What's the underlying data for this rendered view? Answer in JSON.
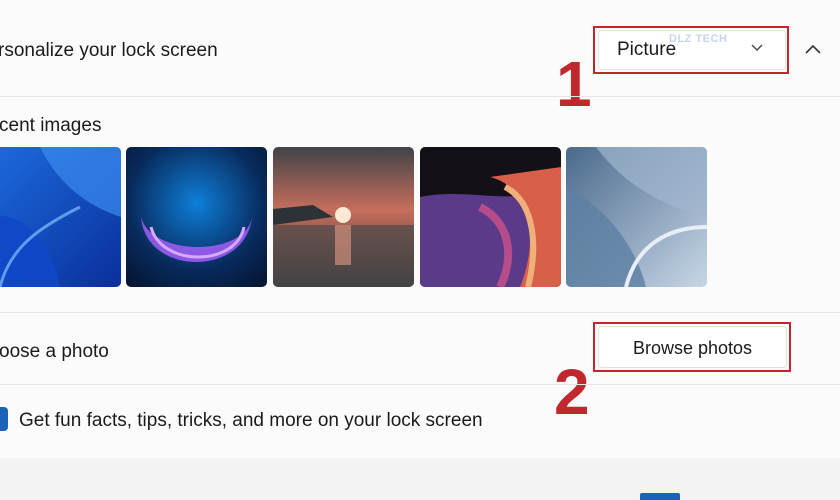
{
  "lock_screen": {
    "title": "rsonalize your lock screen",
    "selected_option": "Picture",
    "watermark": "DLZ TECH"
  },
  "recent_images": {
    "label": "cent images",
    "items": [
      "bloom-blue",
      "bloom-glow",
      "lake-sunset",
      "ribbon-color",
      "wave-grey"
    ]
  },
  "choose_photo": {
    "label": "oose a photo",
    "browse_label": "Browse photos"
  },
  "fun_facts": {
    "label": "Get fun facts, tips, tricks, and more on your lock screen",
    "checked": true
  },
  "annotations": {
    "step1": "1",
    "step2": "2"
  },
  "colors": {
    "annotation_red": "#c0282d",
    "accent_blue": "#1a63b8"
  },
  "icons": [
    "chevron-down-icon",
    "chevron-up-icon"
  ]
}
